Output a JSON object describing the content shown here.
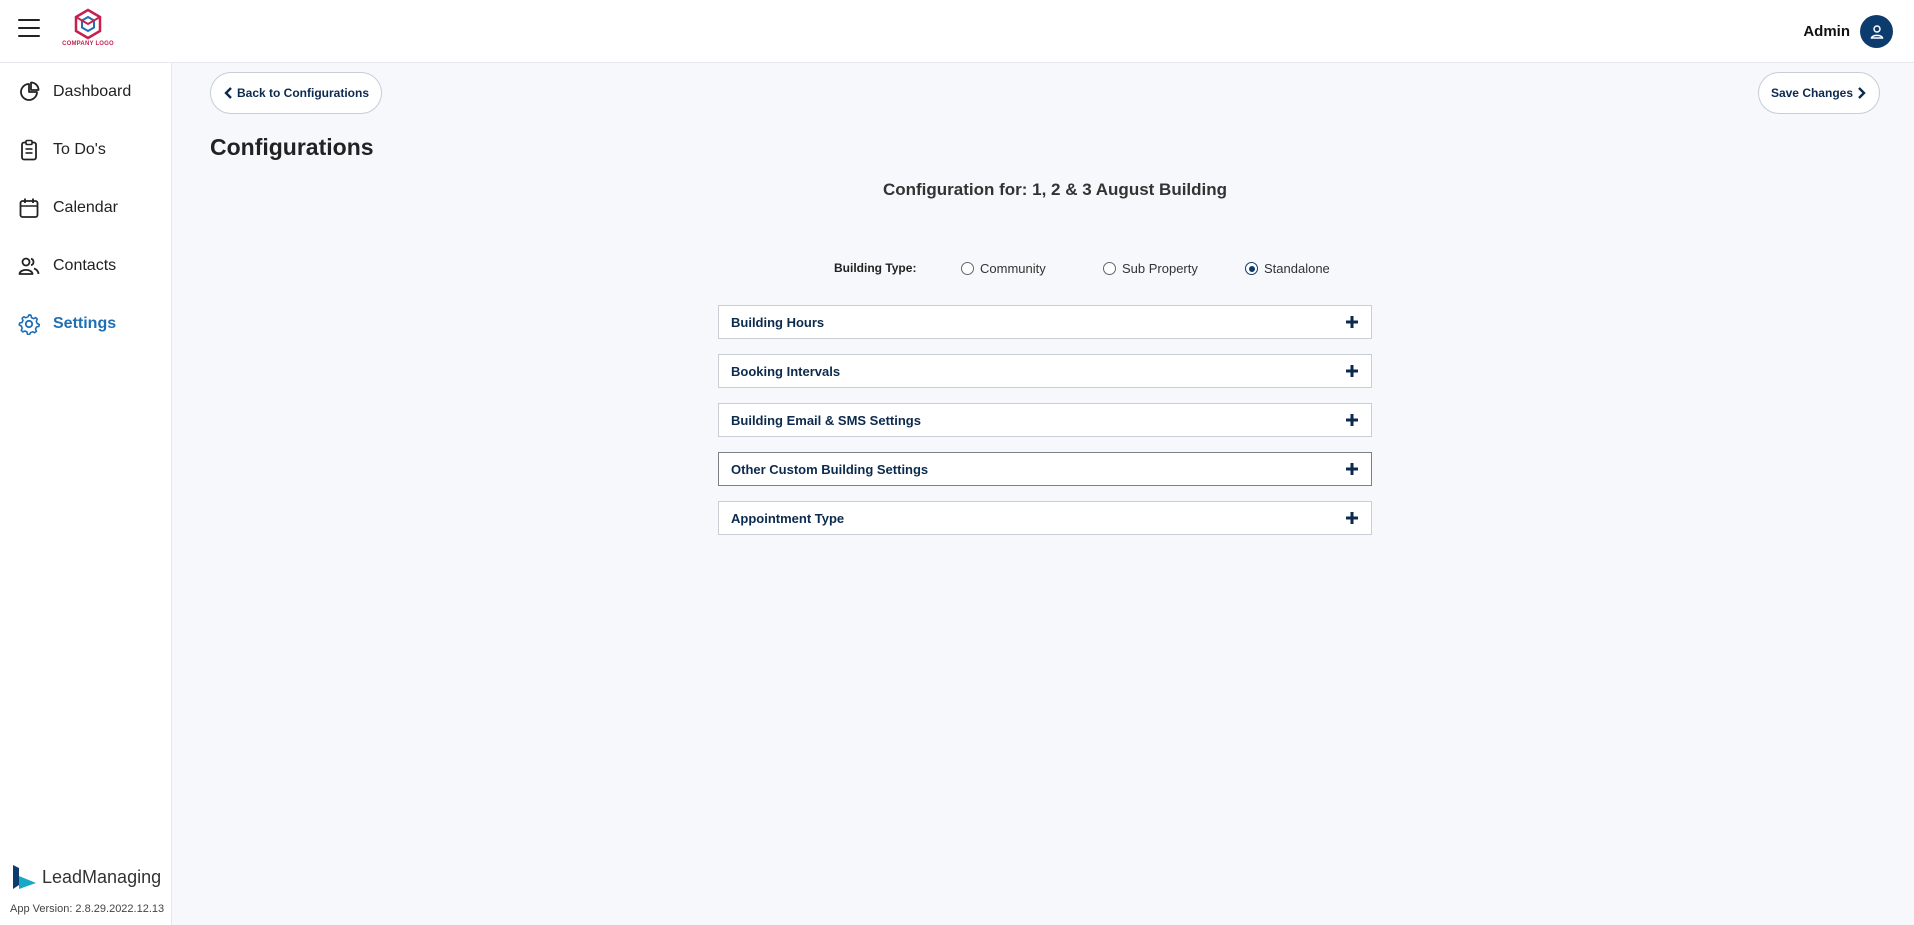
{
  "header": {
    "logo_text": "COMPANY LOGO",
    "user_name": "Admin"
  },
  "sidebar": {
    "items": [
      {
        "label": "Dashboard",
        "icon": "pie-chart-icon"
      },
      {
        "label": "To Do's",
        "icon": "clipboard-icon"
      },
      {
        "label": "Calendar",
        "icon": "calendar-icon"
      },
      {
        "label": "Contacts",
        "icon": "users-icon"
      },
      {
        "label": "Settings",
        "icon": "gear-icon",
        "active": true
      }
    ],
    "brand_name": "LeadManaging",
    "app_version": "App Version: 2.8.29.2022.12.13"
  },
  "main": {
    "back_label": "Back to Configurations",
    "save_label": "Save Changes",
    "page_title": "Configurations",
    "config_for": "Configuration for: 1, 2 & 3 August Building",
    "building_type_label": "Building Type:",
    "building_types": [
      "Community",
      "Sub Property",
      "Standalone"
    ],
    "building_type_selected": "Standalone",
    "sections": [
      "Building Hours",
      "Booking Intervals",
      "Building Email & SMS Settings",
      "Other Custom Building Settings",
      "Appointment Type"
    ]
  },
  "colors": {
    "accent": "#0c3b6e",
    "active_nav": "#1f6fb5",
    "logo": "#c6214d"
  }
}
